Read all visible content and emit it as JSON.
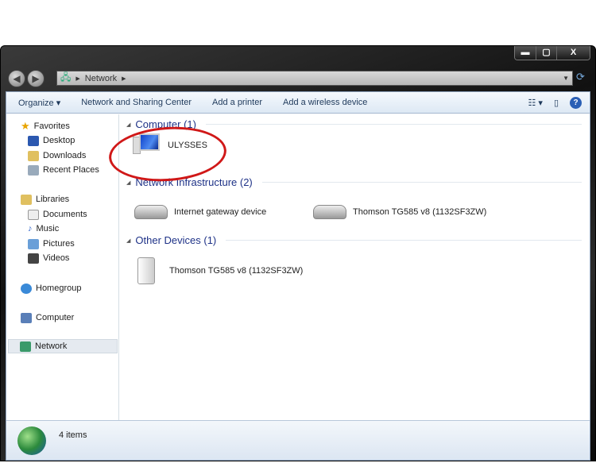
{
  "window": {
    "minimize": "▬",
    "maximize": "▢",
    "close": "X"
  },
  "address": {
    "path": [
      "Network"
    ]
  },
  "toolbar": {
    "organize": "Organize ▾",
    "sharing": "Network and Sharing Center",
    "printer": "Add a printer",
    "wireless": "Add a wireless device"
  },
  "sidebar": {
    "items": [
      {
        "label": "Favorites"
      },
      {
        "label": "Desktop"
      },
      {
        "label": "Downloads"
      },
      {
        "label": "Recent Places"
      },
      {
        "label": "Libraries"
      },
      {
        "label": "Documents"
      },
      {
        "label": "Music"
      },
      {
        "label": "Pictures"
      },
      {
        "label": "Videos"
      },
      {
        "label": "Homegroup"
      },
      {
        "label": "Computer"
      },
      {
        "label": "Network"
      }
    ]
  },
  "groups": [
    {
      "title": "Computer (1)",
      "items": [
        {
          "label": "ULYSSES"
        }
      ]
    },
    {
      "title": "Network Infrastructure (2)",
      "items": [
        {
          "label": "Internet gateway device"
        },
        {
          "label": "Thomson TG585 v8 (1132SF3ZW)"
        }
      ]
    },
    {
      "title": "Other Devices (1)",
      "items": [
        {
          "label": "Thomson TG585 v8 (1132SF3ZW)"
        }
      ]
    }
  ],
  "status": {
    "count": "4 items"
  },
  "colors": {
    "highlight": "#d01818",
    "group_heading": "#1e3287"
  }
}
